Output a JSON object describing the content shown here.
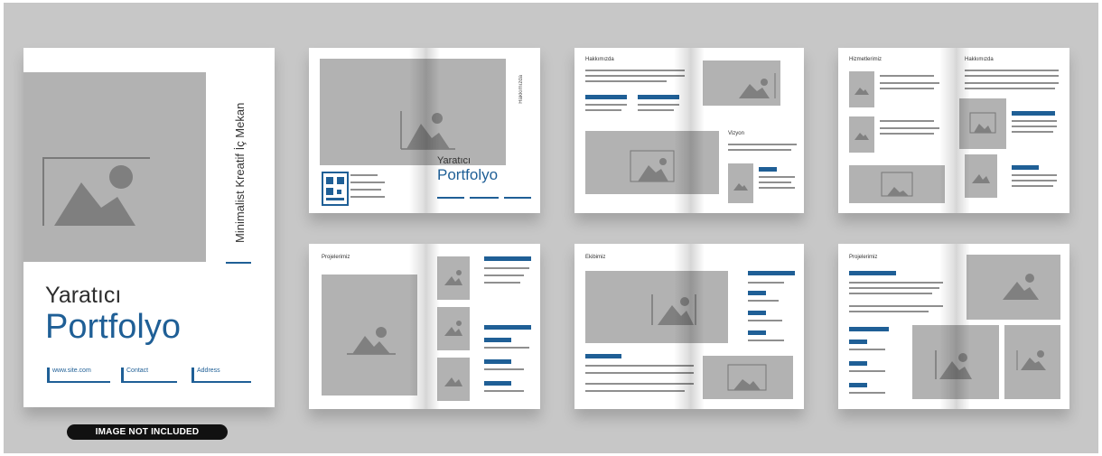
{
  "cover": {
    "vertical_title": "Minimalist Kreatif İç Mekan",
    "title_line1": "Yaratıcı",
    "title_line2": "Portfolyo",
    "chips": [
      "www.site.com",
      "Contact",
      "Address"
    ]
  },
  "spread1": {
    "title_line1": "Yaratıcı",
    "title_line2": "Portfolyo",
    "vertical": "Hakkımızda"
  },
  "badge": "IMAGE NOT INCLUDED",
  "colors": {
    "accent": "#1f5f96",
    "placeholder": "#b2b2b2",
    "background": "#c7c7c7"
  }
}
